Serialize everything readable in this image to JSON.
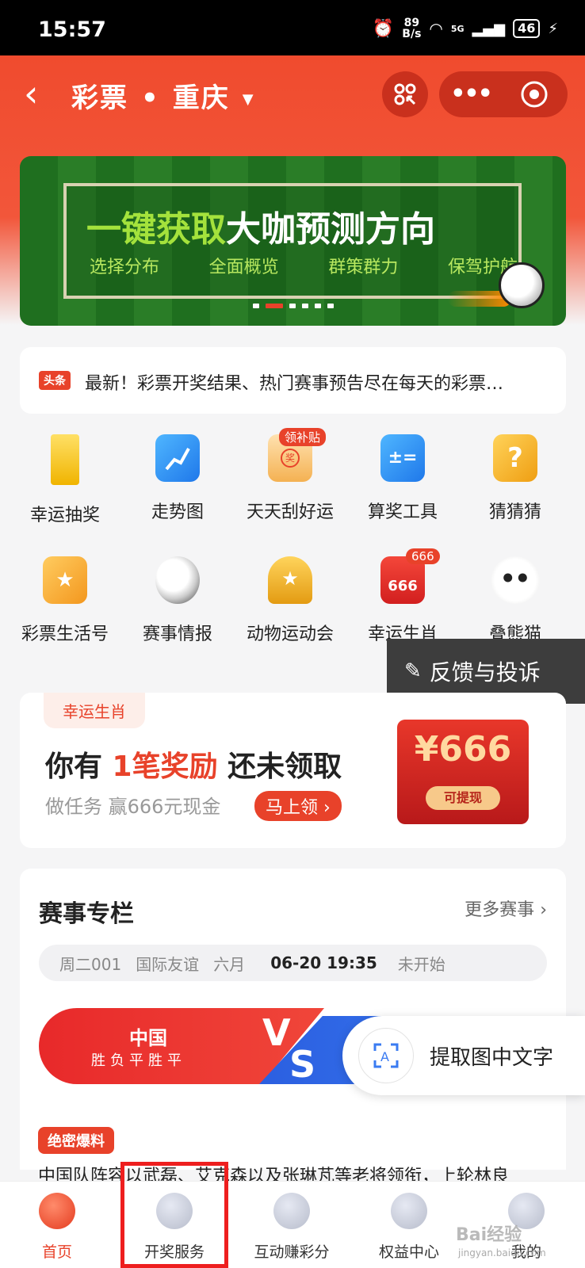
{
  "status": {
    "time": "15:57",
    "net_speed_top": "89",
    "net_speed_bottom": "B/s",
    "signal": "5G",
    "battery": "46"
  },
  "header": {
    "title": "彩票",
    "location": "重庆"
  },
  "banner": {
    "headline_green": "一键获取",
    "headline_white": "大咖预测方向",
    "subs": [
      "选择分布",
      "全面概览",
      "群策群力",
      "保驾护航"
    ]
  },
  "news": {
    "tag": "头条",
    "text": "最新！彩票开奖结果、热门赛事预告尽在每天的彩票…"
  },
  "grid": [
    {
      "label": "幸运抽奖",
      "icon": "gold-bar-icon",
      "color": "#f6c21a"
    },
    {
      "label": "走势图",
      "icon": "trend-chart-icon",
      "color": "#2f8ff5"
    },
    {
      "label": "天天刮好运",
      "icon": "scratch-ticket-icon",
      "color": "#f6b04a",
      "badge": "领补贴"
    },
    {
      "label": "算奖工具",
      "icon": "calculator-icon",
      "color": "#2f8ff5"
    },
    {
      "label": "猜猜猜",
      "icon": "question-icon",
      "color": "#f0a21a"
    },
    {
      "label": "彩票生活号",
      "icon": "star-flag-icon",
      "color": "#f5a832"
    },
    {
      "label": "赛事情报",
      "icon": "soccer-ball-icon",
      "color": "#333333"
    },
    {
      "label": "动物运动会",
      "icon": "trophy-icon",
      "color": "#f0b030"
    },
    {
      "label": "幸运生肖",
      "icon": "red-envelope-icon",
      "color": "#e8422a",
      "badge": "666",
      "icon_text": "666"
    },
    {
      "label": "叠熊猫",
      "icon": "panda-icon",
      "color": "#444444"
    }
  ],
  "feedback": {
    "label": "反馈与投诉"
  },
  "promo": {
    "tag": "幸运生肖",
    "h_pre": "你有 ",
    "h_red": "1笔奖励",
    "h_post": " 还未领取",
    "sub": "做任务 赢666元现金",
    "button": "马上领 ›",
    "amount": "¥666",
    "withdraw": "可提现"
  },
  "events": {
    "title": "赛事专栏",
    "more": "更多赛事",
    "match_no": "周二001",
    "league": "国际友谊",
    "round": "六月",
    "datetime": "06-20 19:35",
    "status": "未开始",
    "home_team": "中国",
    "home_record": "胜负平胜平",
    "vs_v": "V",
    "vs_s": "S"
  },
  "ocr": {
    "label": "提取图中文字"
  },
  "scoop": {
    "tag": "绝密爆料",
    "text": "中国队阵容以武磊、艾克森以及张琳芃等老将领衔，上轮林良"
  },
  "tabs": [
    {
      "label": "首页",
      "icon": "home-mascot-icon"
    },
    {
      "label": "开奖服务",
      "icon": "lottery-ball-icon"
    },
    {
      "label": "互动赚彩分",
      "icon": "planet-icon"
    },
    {
      "label": "权益中心",
      "icon": "clover-icon"
    },
    {
      "label": "我的",
      "icon": "profile-icon"
    }
  ],
  "watermark": {
    "text": "Bai经验",
    "sub": "jingyan.baidu.com"
  }
}
